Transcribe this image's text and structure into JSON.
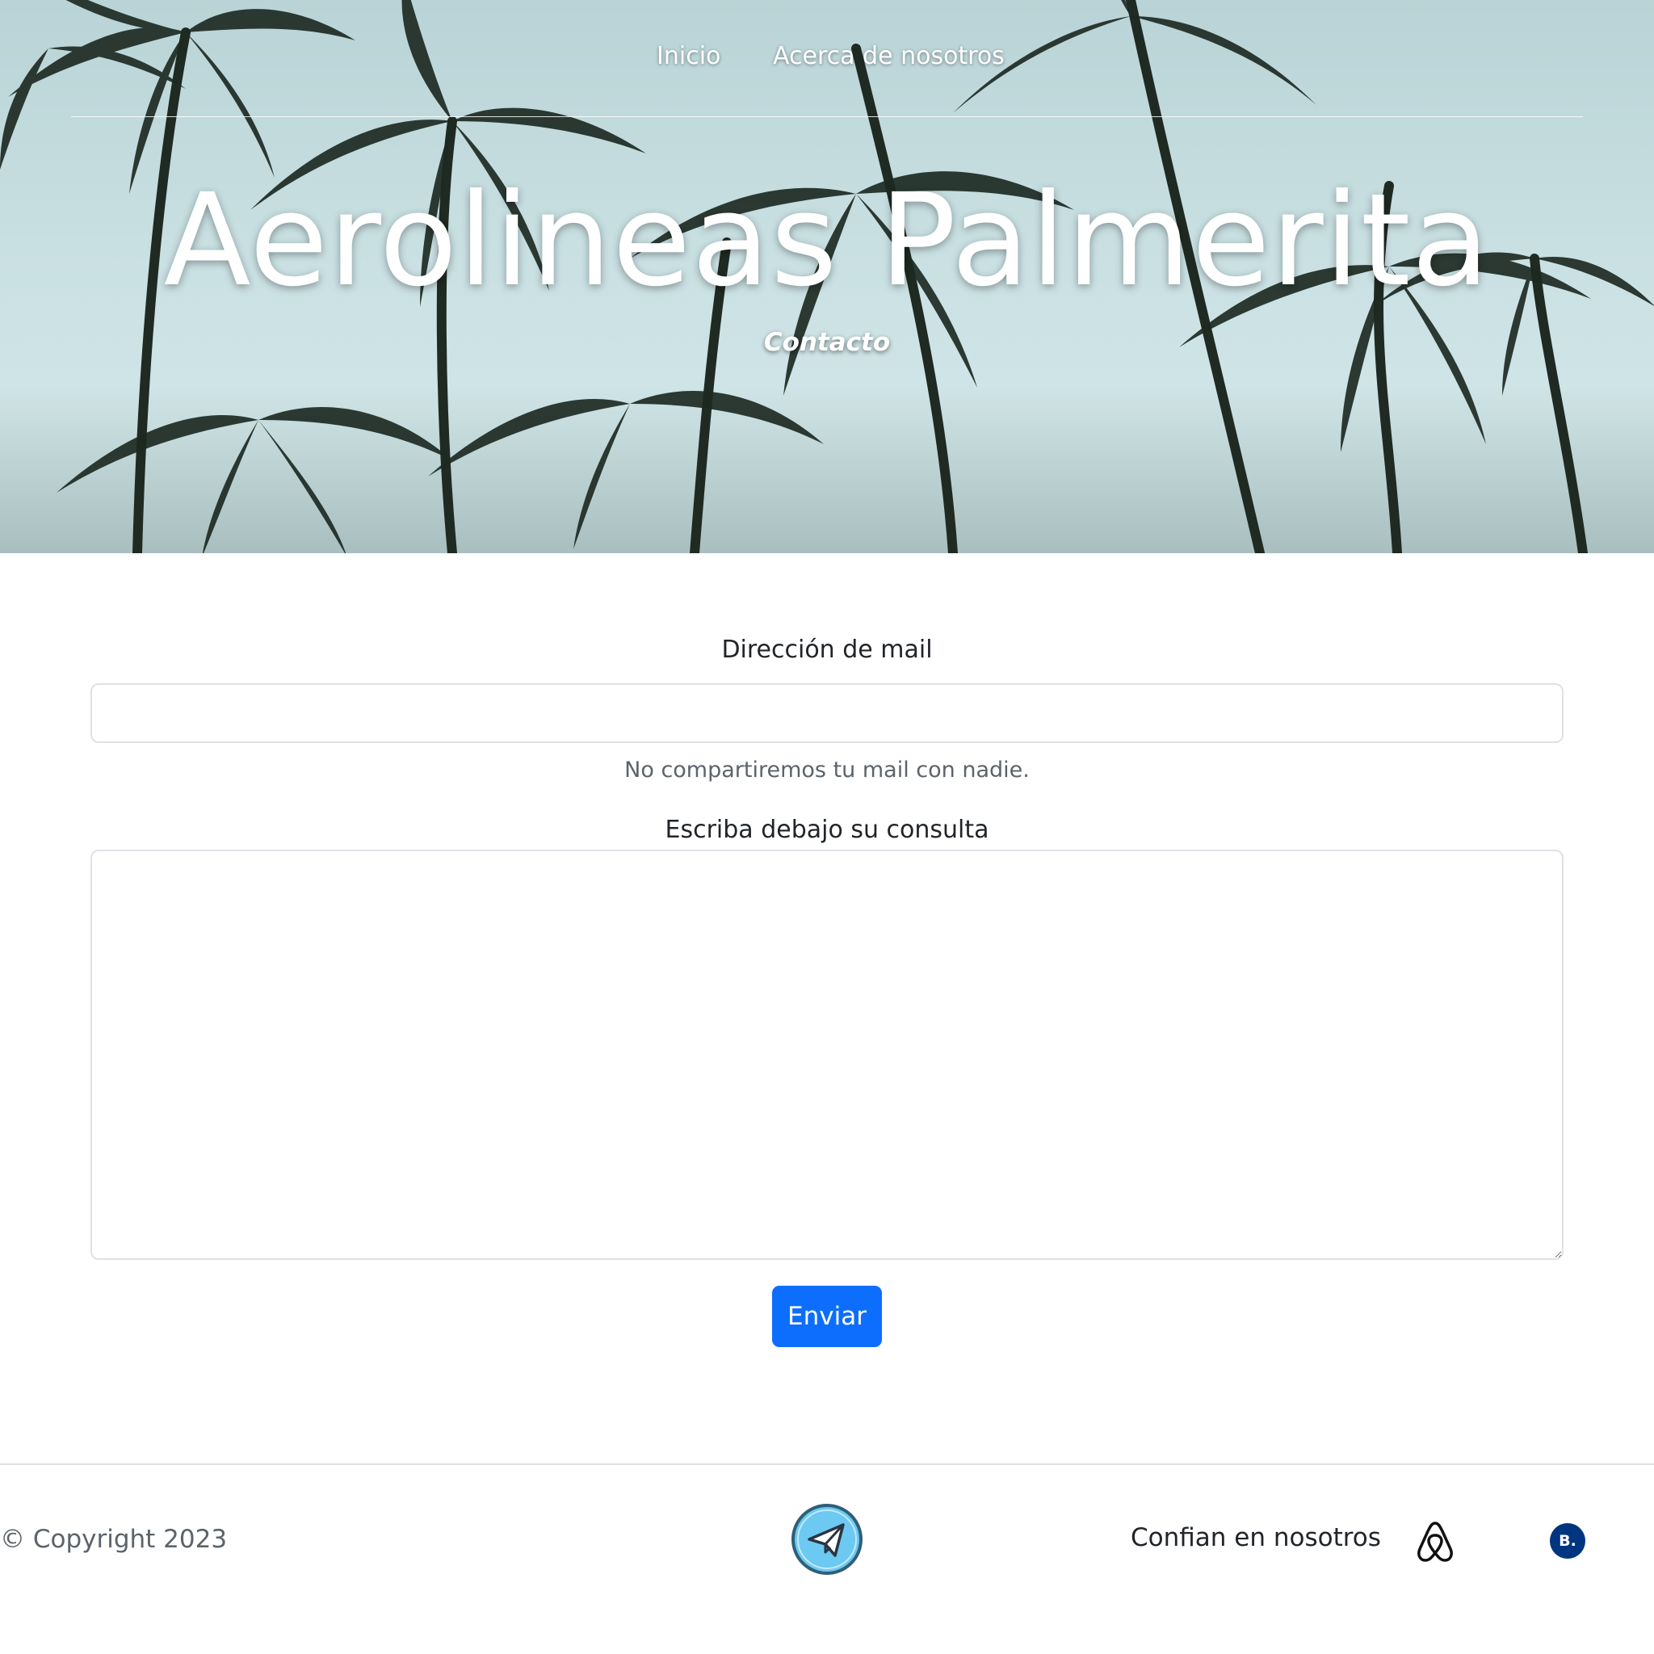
{
  "nav": {
    "items": [
      {
        "label": "Inicio"
      },
      {
        "label": "Acerca de nosotros"
      }
    ]
  },
  "hero": {
    "title": "Aerolineas Palmerita",
    "subtitle": "Contacto"
  },
  "form": {
    "email_label": "Dirección de mail",
    "email_value": "",
    "email_help": "No compartiremos tu mail con nadie.",
    "query_label": "Escriba debajo su consulta",
    "query_value": "",
    "submit_label": "Enviar",
    "submit_color": "#0d6efd"
  },
  "footer": {
    "copyright": "© Copyright 2023",
    "center_icon": "paper-plane-icon",
    "trust_label": "Confian en nosotros",
    "partners": [
      {
        "icon": "airbnb-icon"
      },
      {
        "icon": "booking-icon",
        "text": "B."
      }
    ]
  }
}
